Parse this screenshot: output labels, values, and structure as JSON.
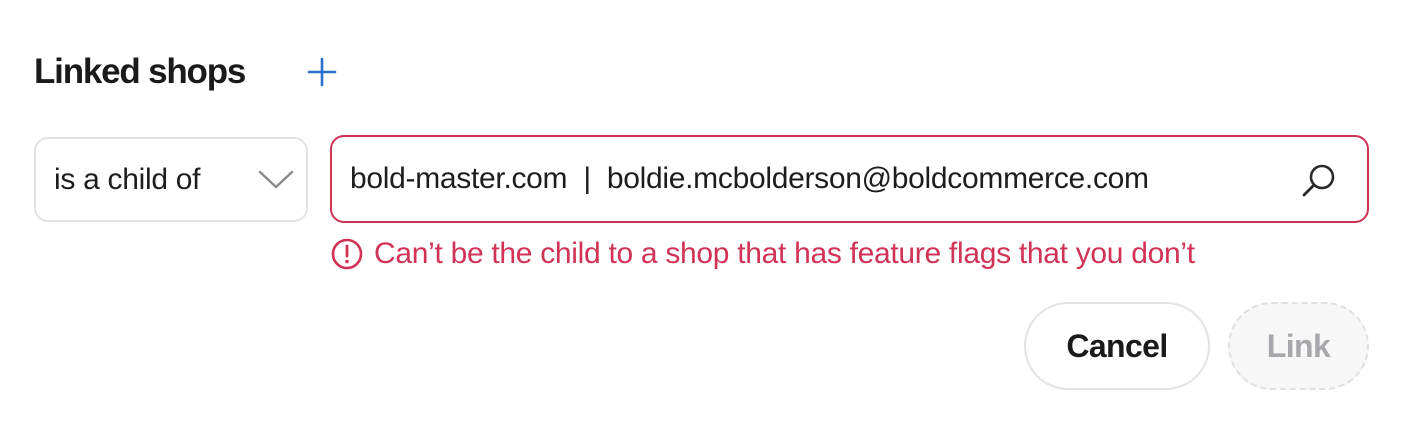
{
  "section": {
    "title": "Linked shops",
    "add_icon": "plus-icon"
  },
  "relation_select": {
    "value": "is a child of",
    "icon": "chevron-down-icon"
  },
  "shop_search": {
    "value": "bold-master.com  |  boldie.mcbolderson@boldcommerce.com",
    "icon": "search-icon"
  },
  "error": {
    "message": "Can’t be the child to a shop that has feature flags that you don’t",
    "icon": "alert-circle-icon",
    "color": "#d03355"
  },
  "actions": {
    "cancel_label": "Cancel",
    "link_label": "Link"
  },
  "colors": {
    "accent": "#2c6ecb",
    "error": "#cc3355"
  }
}
